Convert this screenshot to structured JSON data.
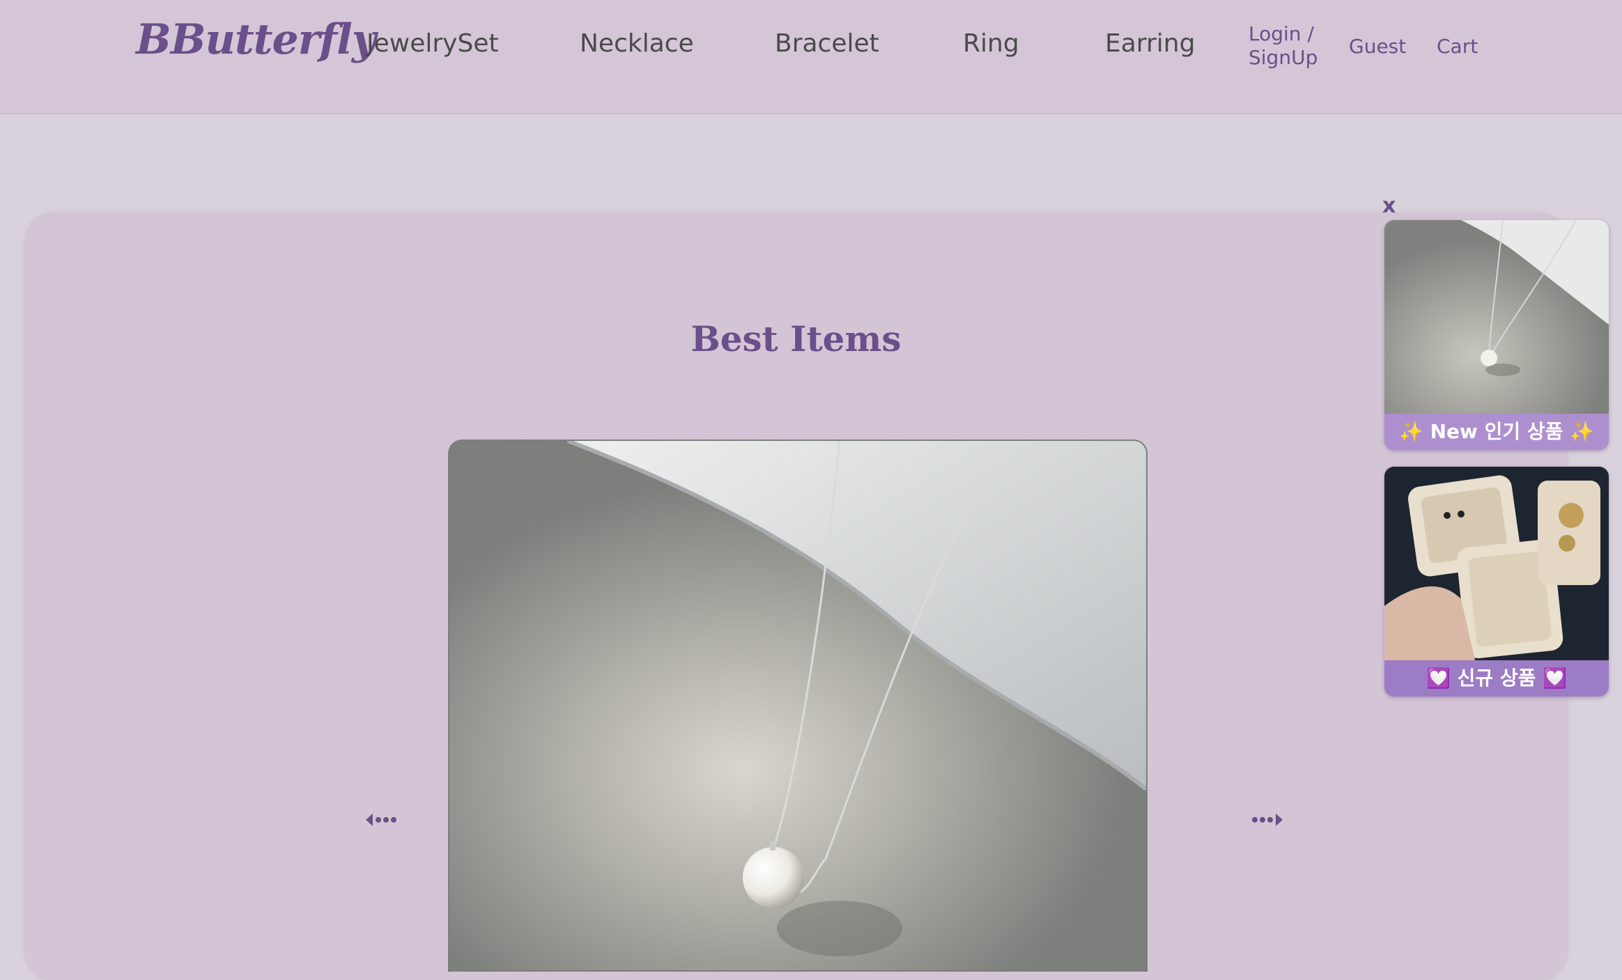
{
  "header": {
    "logo": "BButterfly",
    "nav": [
      "JewelrySet",
      "Necklace",
      "Bracelet",
      "Ring",
      "Earring"
    ],
    "login_line1": "Login /",
    "login_line2": "SignUp",
    "guest": "Guest",
    "cart": "Cart"
  },
  "main": {
    "section_title": "Best Items",
    "hero_image": "pearl-necklace-image",
    "prev_icon": "prev-arrow-icon",
    "next_icon": "next-arrow-icon"
  },
  "popup": {
    "close_label": "x",
    "cards": [
      {
        "image": "pearl-necklace-thumbnail",
        "caption": "✨ New 인기 상품 ✨"
      },
      {
        "image": "jewelry-box-thumbnail",
        "caption": "💟 신규 상품 💟"
      }
    ]
  },
  "colors": {
    "accent": "#6b4f8a",
    "header_bg": "#d4c6d7",
    "page_bg": "#d9d1dc",
    "card_bg": "#d4c5d6",
    "popup_caption_bg": "#ad8fd0"
  }
}
